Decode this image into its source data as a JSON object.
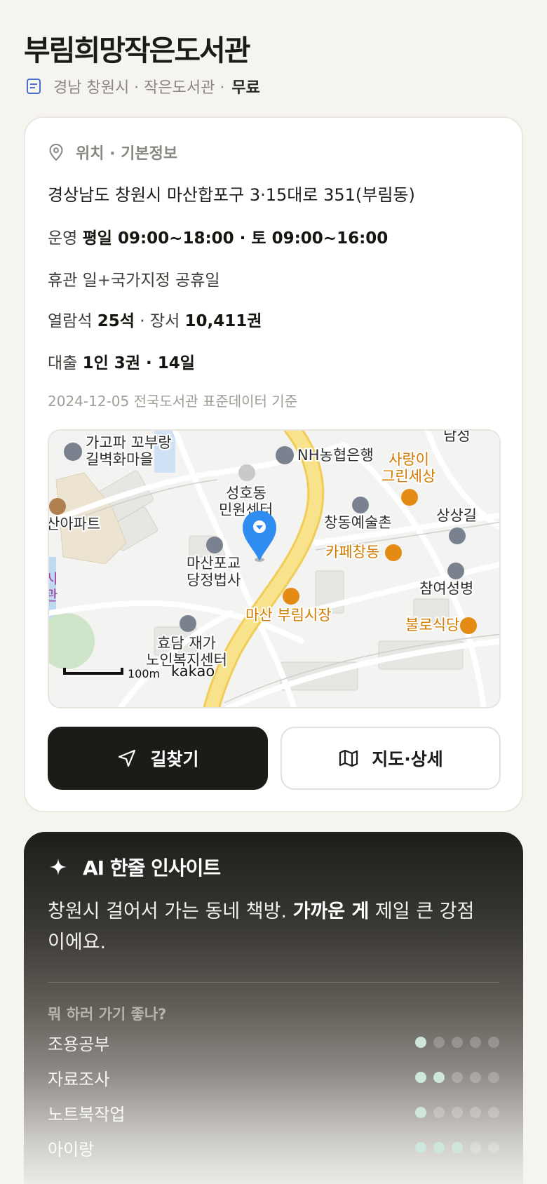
{
  "library": {
    "name": "부림희망작은도서관",
    "meta": "경남 창원시 · 작은도서관 ·",
    "fee": "무료"
  },
  "info": {
    "section_title": "위치 · 기본정보",
    "address": "경상남도 창원시 마산합포구 3·15대로 351(부림동)",
    "hours_label": "운영",
    "hours_value": "평일 09:00~18:00 · 토 09:00~16:00",
    "closed_label": "휴관",
    "closed_value": "일+국가지정 공휴일",
    "seats_label": "열람석",
    "seats_value": "25석",
    "books_sep": "· 장서",
    "books_value": "10,411권",
    "loan_label": "대출",
    "loan_value": "1인 3권 · 14일",
    "source": "2024-12-05 전국도서관 표준데이터 기준"
  },
  "map": {
    "scale": "100m",
    "brand": "kakao",
    "pois": {
      "p1a": "가고파 꼬부랑",
      "p1b": "길벽화마을",
      "p2": "NH농협은행",
      "p3a": "사랑이",
      "p3b": "그린세상",
      "p4": "남성",
      "p5a": "성호동",
      "p5b": "민원센터",
      "p6": "산아파트",
      "p7": "창동예술촌",
      "p8": "상상길",
      "p9a": "마산포교",
      "p9b": "당정법사",
      "p10": "카페창동",
      "p11": "참여성병",
      "p12": "마산 부림시장",
      "p13": "불로식당",
      "p14a": "효담 재가",
      "p14b": "노인복지센터",
      "p15a": "시",
      "p15b": "관"
    }
  },
  "actions": {
    "route": "길찾기",
    "map_detail": "지도·상세"
  },
  "ai": {
    "title": "AI 한줄 인사이트",
    "text_pre": "창원시 걸어서 가는 동네 책방. ",
    "text_bold": "가까운 게",
    "text_post": " 제일 큰 강점이에요.",
    "question": "뭐 하러 가기 좋나?",
    "activities": [
      {
        "label": "조용공부",
        "score": 1
      },
      {
        "label": "자료조사",
        "score": 2
      },
      {
        "label": "노트북작업",
        "score": 1
      },
      {
        "label": "아이랑",
        "score": 3
      }
    ]
  },
  "colors": {
    "accent_dark": "#1d1b18",
    "pin_blue": "#2f8df2",
    "road_yellow": "#f7df7c",
    "poi_orange": "#d27a00",
    "dot_on": "#cfe6dc"
  }
}
